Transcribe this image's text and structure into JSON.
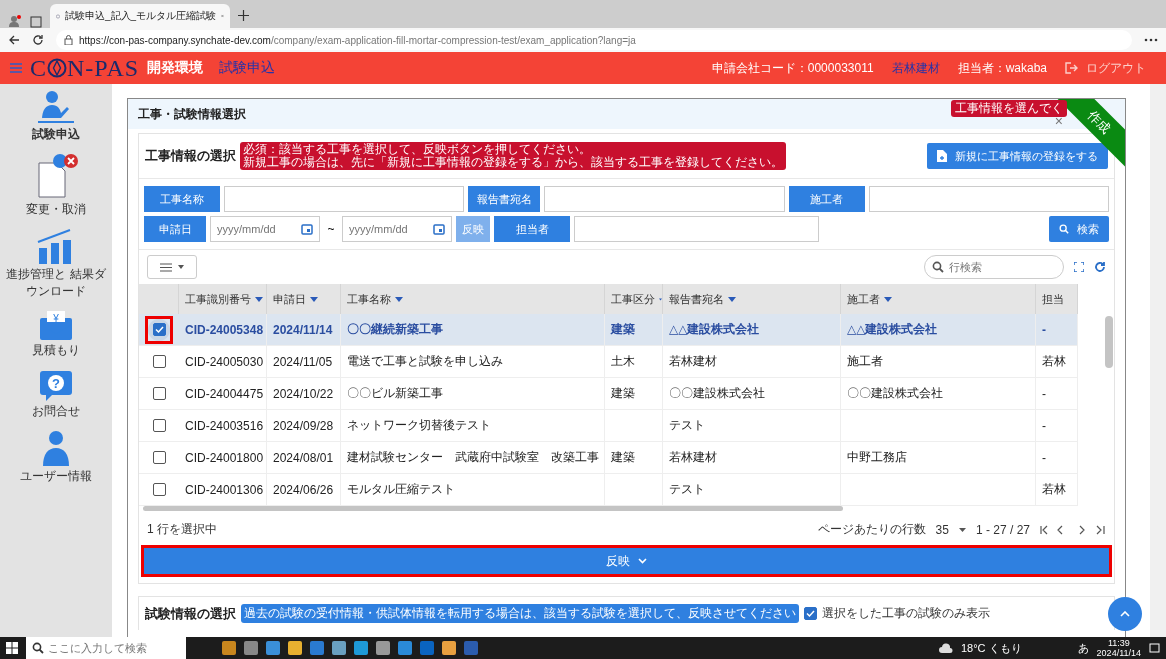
{
  "browser": {
    "tabs": [
      {
        "title": "試験申込_記入_モルタル圧縮試験",
        "selected": true
      }
    ],
    "url_host": "https://con-pas-company.synchate-dev.com",
    "url_path": "/company/exam-application-fill-mortar-compression-test/exam_application?lang=ja"
  },
  "header": {
    "logo_left": "C",
    "logo_right": "N-PAS",
    "env": "開発環境",
    "page": "試験申込",
    "company_code": "申請会社コード：0000033011",
    "company": "若林建材",
    "person": "担当者：wakaba",
    "logout": "ログアウト"
  },
  "sidebar": {
    "items": [
      {
        "kind": "apply",
        "label": "試験申込",
        "selected": true
      },
      {
        "kind": "change",
        "label": "変更・取消",
        "selected": false
      },
      {
        "kind": "progress",
        "label": "進捗管理と 結果ダウンロード",
        "selected": false
      },
      {
        "kind": "estimate",
        "label": "見積もり",
        "selected": false,
        "glyph": "¥"
      },
      {
        "kind": "contact",
        "label": "お問合せ",
        "selected": false,
        "glyph": "?"
      },
      {
        "kind": "user",
        "label": "ユーザー情報",
        "selected": false
      }
    ]
  },
  "card": {
    "title": "工事・試験情報選択",
    "ribbon": "作成",
    "badge": "工事情報を選んでく",
    "close": "×"
  },
  "project_section": {
    "title": "工事情報の選択",
    "note": [
      "必須：該当する工事を選択して、反映ボタンを押してください。",
      "新規工事の場合は、先に「新規に工事情報の登録をする」から、該当する工事を登録してください。"
    ],
    "register_button": "新規に工事情報の登録をする",
    "filters": {
      "project_name": "工事名称",
      "report_to": "報告書宛名",
      "contractor": "施工者",
      "date": "申請日",
      "date_from_placeholder": "yyyy/mm/dd",
      "tilde": "~",
      "date_to_placeholder": "yyyy/mm/dd",
      "apply_small": "反映",
      "person": "担当者",
      "search": "検索"
    },
    "row_search_placeholder": "行検索",
    "table": {
      "columns": [
        "工事識別番号",
        "申請日",
        "工事名称",
        "工事区分",
        "報告書宛名",
        "施工者",
        "担当"
      ],
      "rows": [
        {
          "selected": true,
          "highlighted": true,
          "cells": [
            "CID-24005348",
            "2024/11/14",
            "〇〇継続新築工事",
            "建築",
            "△△建設株式会社",
            "△△建設株式会社",
            "-"
          ]
        },
        {
          "selected": false,
          "highlighted": false,
          "cells": [
            "CID-24005030",
            "2024/11/05",
            "電送で工事と試験を申し込み",
            "土木",
            "若林建材",
            "施工者",
            "若林"
          ]
        },
        {
          "selected": false,
          "highlighted": false,
          "cells": [
            "CID-24004475",
            "2024/10/22",
            "〇〇ビル新築工事",
            "建築",
            "〇〇建設株式会社",
            "〇〇建設株式会社",
            "-"
          ]
        },
        {
          "selected": false,
          "highlighted": false,
          "cells": [
            "CID-24003516",
            "2024/09/28",
            "ネットワーク切替後テスト",
            "",
            "テスト",
            "",
            "-"
          ]
        },
        {
          "selected": false,
          "highlighted": false,
          "cells": [
            "CID-24001800",
            "2024/08/01",
            "建材試験センター　武蔵府中試験室　改築工事",
            "建築",
            "若林建材",
            "中野工務店",
            "-"
          ]
        },
        {
          "selected": false,
          "highlighted": false,
          "cells": [
            "CID-24001306",
            "2024/06/26",
            "モルタル圧縮テスト",
            "",
            "テスト",
            "",
            "若林"
          ]
        }
      ]
    },
    "selected_count": "1 行を選択中",
    "rows_per_page_label": "ページあたりの行数",
    "rows_per_page": "35",
    "range": "1 - 27 / 27",
    "reflect_button": {
      "label": "反映",
      "highlighted": true
    }
  },
  "test_section": {
    "title": "試験情報の選択",
    "note": "過去の試験の受付情報・供試体情報を転用する場合は、該当する試験を選択して、反映させてください",
    "filter_label": "選択をした工事の試験のみ表示",
    "filter_checked": true
  },
  "taskbar": {
    "search_placeholder": "ここに入力して検索",
    "weather": "18°C くもり",
    "ime": "あ",
    "time": "11:39",
    "date": "2024/11/14"
  }
}
